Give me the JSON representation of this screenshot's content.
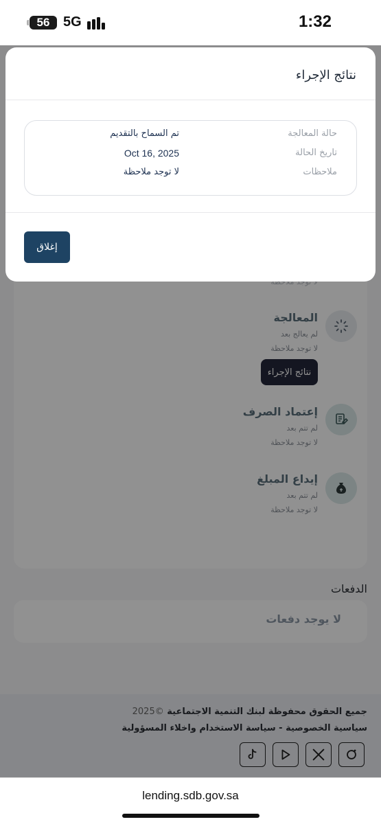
{
  "status_bar": {
    "battery": "56",
    "network": "5G",
    "time": "1:32"
  },
  "modal": {
    "title": "نتائج الإجراء",
    "rows": [
      {
        "label": "حالة المعالجة",
        "value": "تم السماح بالتقديم"
      },
      {
        "label": "تاريخ الحالة",
        "value": "Oct 16, 2025"
      },
      {
        "label": "ملاحظات",
        "value": "لا توجد ملاحظة"
      }
    ],
    "close_label": "إغلاق"
  },
  "timeline": {
    "faint_text": "لا توجد ملاحظة",
    "steps": [
      {
        "title": "المعالجة",
        "status": "لم يعالج بعد",
        "note": "لا توجد ملاحظة",
        "icon": "processing-icon"
      },
      {
        "title": "إعتماد الصرف",
        "status": "لم تتم بعد",
        "note": "لا توجد ملاحظة",
        "icon": "disbursement-approval-icon"
      },
      {
        "title": "إيداع المبلغ",
        "status": "لم تتم بعد",
        "note": "لا توجد ملاحظة",
        "icon": "money-bag-icon"
      }
    ],
    "action_button": "نتائج الإجراء"
  },
  "payments": {
    "heading": "الدفعات",
    "empty": "لا يوجد دفعات"
  },
  "footer": {
    "rights": "جميع الحقوق محفوظة لبنك التنمية الاجتماعية",
    "year": "©2025",
    "links": "سياسية الخصوصية - سياسة الاستخدام واخلاء المسؤولية",
    "socials": [
      "instagram-icon",
      "x-icon",
      "youtube-icon",
      "tiktok-icon"
    ]
  },
  "browser": {
    "url": "lending.sdb.gov.sa"
  }
}
